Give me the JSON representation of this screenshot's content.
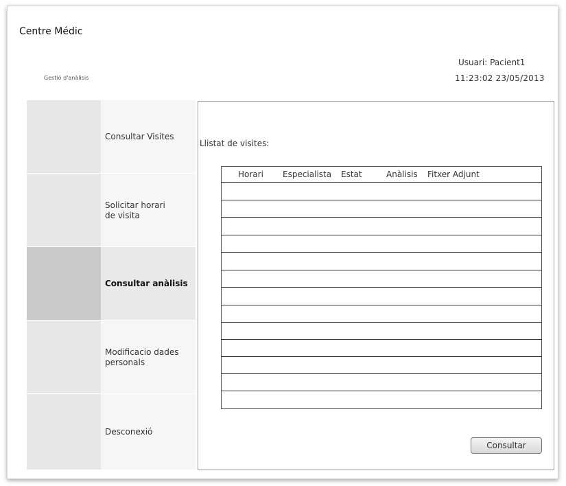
{
  "app": {
    "title": "Centre Médic",
    "section": "Gestió d'anàlisis"
  },
  "header": {
    "user": "Usuari: Pacient1",
    "datetime": "11:23:02 23/05/2013"
  },
  "sidebar": {
    "items": [
      {
        "label": "Consultar Visites",
        "active": false
      },
      {
        "label": "Solicitar horari\nde visita",
        "active": false
      },
      {
        "label": "Consultar anàlisis",
        "active": true
      },
      {
        "label": "Modificacio dades\npersonals",
        "active": false
      },
      {
        "label": "Desconexió",
        "active": false
      }
    ]
  },
  "main": {
    "list_title": "Llistat de visites:",
    "table": {
      "columns": [
        "Horari",
        "Especialista",
        "Estat",
        "Anàlisis",
        "Fitxer Adjunt"
      ],
      "rows": []
    },
    "consult_button": "Consultar"
  }
}
